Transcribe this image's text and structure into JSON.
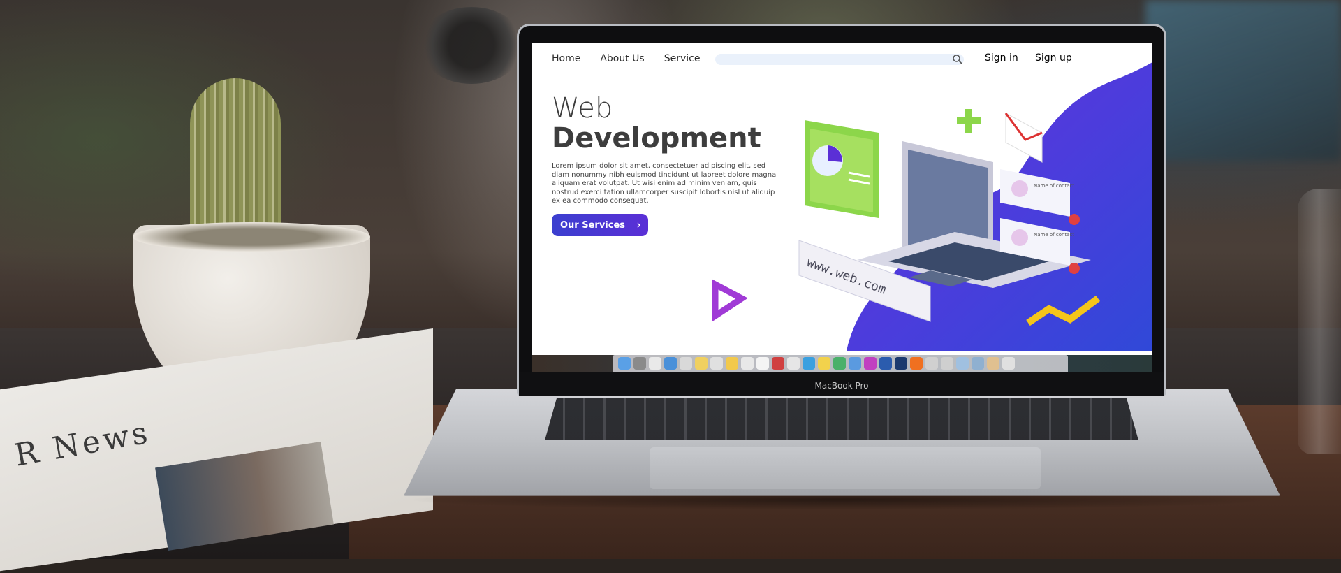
{
  "site": {
    "nav": [
      "Home",
      "About Us",
      "Service"
    ],
    "sign_in": "Sign in",
    "sign_up": "Sign up",
    "hero_title_light": "Web",
    "hero_title_bold": "Development",
    "hero_body": "Lorem ipsum dolor sit amet, consectetuer adipiscing elit, sed diam nonummy nibh euismod tincidunt ut laoreet dolore magna aliquam erat volutpat. Ut wisi enim ad minim veniam, quis nostrud exerci tation ullamcorper suscipit lobortis nisl ut aliquip ex ea commodo consequat.",
    "cta": "Our Services",
    "url_card": "www.web.com",
    "contact_card_title": "Name of contact",
    "accent_colors": {
      "purple": "#5b2fd6",
      "blue": "#3b3fcf",
      "green": "#8cd64a",
      "yellow": "#f5c51a"
    }
  },
  "laptop": {
    "brand": "MacBook Pro"
  },
  "newspaper": {
    "masthead": "R News"
  },
  "dock_icon_colors": [
    "#5aa0e6",
    "#8a8a8a",
    "#e9e9e9",
    "#4a90d9",
    "#d9d9d9",
    "#f0d060",
    "#e0e0e0",
    "#f2c94c",
    "#e8e8e8",
    "#f4f4f4",
    "#d04040",
    "#e6e6e6",
    "#3aa0e0",
    "#f2d24c",
    "#4ab06a",
    "#5a9ae0",
    "#c040c0",
    "#2b5cae",
    "#1c3a6e",
    "#f07020",
    "#d0d0d0",
    "#cfcfcf",
    "#a0c0e0",
    "#8fb0d0",
    "#e0c090",
    "#e0e0e0"
  ]
}
